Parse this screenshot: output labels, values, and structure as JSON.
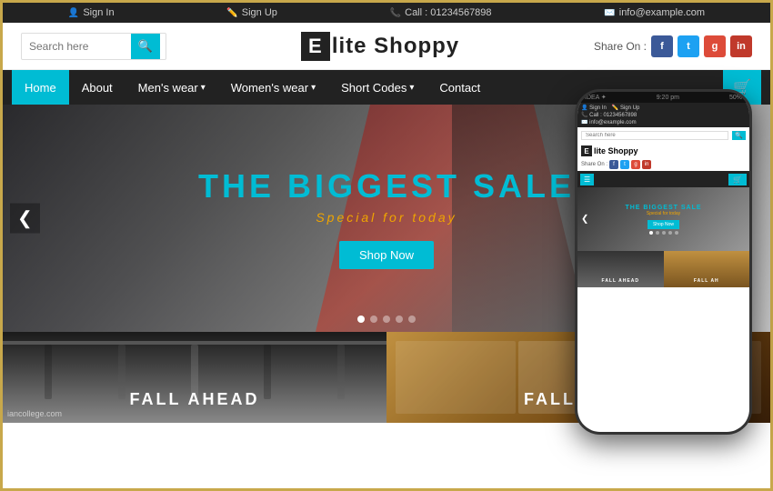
{
  "topbar": {
    "items": [
      {
        "icon": "👤",
        "text": "Sign In"
      },
      {
        "icon": "✏️",
        "text": "Sign Up"
      },
      {
        "icon": "📞",
        "text": "Call : 01234567898"
      },
      {
        "icon": "✉️",
        "text": "info@example.com"
      }
    ]
  },
  "header": {
    "search_placeholder": "Search here",
    "search_icon": "🔍",
    "logo_letter": "E",
    "logo_text": "lite Shoppy",
    "share_label": "Share On :",
    "social": [
      {
        "name": "facebook",
        "letter": "f",
        "color": "#3b5998"
      },
      {
        "name": "twitter",
        "letter": "t",
        "color": "#1da1f2"
      },
      {
        "name": "google-plus",
        "letter": "g",
        "color": "#dd4b39"
      },
      {
        "name": "linkedin",
        "letter": "in",
        "color": "#c0392b"
      }
    ]
  },
  "nav": {
    "items": [
      {
        "label": "Home",
        "active": true,
        "has_dropdown": false
      },
      {
        "label": "About",
        "active": false,
        "has_dropdown": false
      },
      {
        "label": "Men's wear",
        "active": false,
        "has_dropdown": true
      },
      {
        "label": "Women's wear",
        "active": false,
        "has_dropdown": true
      },
      {
        "label": "Short Codes",
        "active": false,
        "has_dropdown": true
      },
      {
        "label": "Contact",
        "active": false,
        "has_dropdown": false
      }
    ],
    "cart_icon": "🛒"
  },
  "hero": {
    "title_part1": "THE BIGGEST ",
    "title_highlight": "SALE",
    "subtitle": "Special for today",
    "button_label": "Shop Now",
    "arrow_left": "❮",
    "dots": [
      true,
      false,
      false,
      false,
      false
    ]
  },
  "thumbnails": [
    {
      "label": "FALL AHEAD",
      "watermark": "iancollege.com"
    },
    {
      "label": "FALL AH..."
    }
  ],
  "phone": {
    "status_left": "IDEA ✦",
    "status_right": "50%",
    "time": "9:20 pm",
    "topbar_items": [
      "👤 Sign In",
      "✏️ Sign Up",
      "📞 Call : 01234567898",
      "✉️ info@example.com"
    ],
    "logo_letter": "E",
    "logo_text": "lite Shoppy",
    "share_label": "Share On :",
    "hero_title": "THE BIGGEST SALE",
    "hero_subtitle": "Special for today",
    "thumb1_label": "FALL AHEAD",
    "thumb2_label": "FALL AH"
  }
}
